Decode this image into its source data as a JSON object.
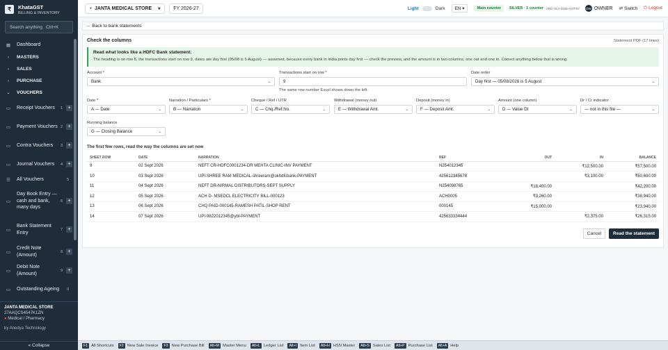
{
  "app": {
    "name": "KhataGST",
    "tagline": "BILLING & INVENTORY"
  },
  "search": {
    "placeholder": "Search anything",
    "shortcut": "Ctrl+K"
  },
  "nav": {
    "dashboard": "Dashboard",
    "masters": "MASTERS",
    "sales": "SALES",
    "purchase": "PURCHASE",
    "vouchers": "VOUCHERS",
    "items": [
      {
        "label": "Receipt Vouchers",
        "count": "1"
      },
      {
        "label": "Payment Vouchers",
        "count": "2"
      },
      {
        "label": "Contra Vouchers",
        "count": "3"
      },
      {
        "label": "Journal Vouchers",
        "count": "4"
      },
      {
        "label": "All Vouchers",
        "count": "5"
      },
      {
        "label": "Day Book Entry — cash and bank, many days",
        "count": "6"
      },
      {
        "label": "Bank Statement Entry",
        "count": "7"
      },
      {
        "label": "Credit Note (Amount)",
        "count": "8"
      },
      {
        "label": "Debit Note (Amount)",
        "count": "9"
      },
      {
        "label": "Outstanding Ageing",
        "count": "0"
      }
    ]
  },
  "footer": {
    "store": "JANTA MEDICAL STORE",
    "gstin": "27AAQCS4547K1ZN",
    "category": "Medical / Pharmacy",
    "by": "by Anedya Technology",
    "collapse": "« Collapse"
  },
  "topbar": {
    "store": "JANTA MEDICAL STORE",
    "fy": "FY 2026-27",
    "light": "Light",
    "dark": "Dark",
    "lang": "EN",
    "main_counter": "Main counter",
    "silver": "SILVER · 1 counter",
    "silver_code": "ANO-SLV-2026-A07F07",
    "owner_initials": "OW",
    "owner": "OWNER",
    "switch": "Switch",
    "logout": "Logout"
  },
  "back": "← Back to bank statements",
  "card": {
    "title": "Check the columns",
    "pdf": "Statement PDF (17 lines)",
    "notice_title": "Read what looks like a HDFC Bank statement.",
    "notice_text": "The heading is on row 8, the transactions start on row 9, dates are day first (05/08 is 5 August) — assumed, because every bank in India prints day first — check the preview, and the amount is in two columns, one out and one in. Correct anything below that is wrong.",
    "account_label": "Account *",
    "account_value": "Bank",
    "txstart_label": "Transactions start on row *",
    "txstart_value": "9",
    "txstart_hint": "The same row number Excel shows down the left.",
    "dateorder_label": "Date order",
    "dateorder_value": "Day first — 05/08/2026 is 5 August",
    "date_label": "Date *",
    "date_value": "A — Date",
    "narr_label": "Narration / Particulars *",
    "narr_value": "B — Narration",
    "cheque_label": "Cheque / Ref / UTR",
    "cheque_value": "C — Chq./Ref.No.",
    "withdraw_label": "Withdrawal (money out)",
    "withdraw_value": "E — Withdrawal Amt.",
    "deposit_label": "Deposit (money in)",
    "deposit_value": "F — Deposit Amt.",
    "amount_label": "Amount (one column)",
    "amount_value": "D — Value Dt",
    "drcr_label": "Dr / Cr indicator",
    "drcr_value": "— not in this file —",
    "balance_label": "Running balance",
    "balance_value": "G — Closing Balance",
    "preview_title": "The first few rows, read the way the columns are set now",
    "cols": [
      "SHEET ROW",
      "DATE",
      "NARRATION",
      "REF",
      "OUT",
      "IN",
      "BALANCE"
    ],
    "rows": [
      [
        "9",
        "02 Sept 2026",
        "NEFT CR-HDFC0001234-DR MEHTA CLINIC-INV PAYMENT",
        "N254012345",
        "",
        "₹12,500.00",
        "₹57,500.00"
      ],
      [
        "10",
        "03 Sept 2026",
        "UPI-SHREE RAM MEDICAL-shreeram@okhdfcbank-PAYMENT",
        "425612345678",
        "",
        "₹3,100.00",
        "₹60,600.00"
      ],
      [
        "11",
        "04 Sept 2026",
        "NEFT DR-NIRMAL DISTRIBUTORS-SEPT SUPPLY",
        "N254098765",
        "₹18,400.00",
        "",
        "₹42,200.00"
      ],
      [
        "12",
        "05 Sept 2026",
        "ACH D- MSEDCL ELECTRICITY BILL-000123",
        "ACH0005",
        "₹3,260.00",
        "",
        "₹38,940.00"
      ],
      [
        "13",
        "06 Sept 2026",
        "CHQ PAID-000145-RAMESH PATIL-SHOP RENT",
        "000145",
        "₹15,000.00",
        "",
        "₹23,940.00"
      ],
      [
        "14",
        "07 Sept 2026",
        "UPI-9822012345@ybl-PAYMENT",
        "425633334444",
        "",
        "₹2,375.00",
        "₹26,315.00"
      ]
    ],
    "cancel": "Cancel",
    "read": "Read the statement"
  },
  "shortcuts": [
    {
      "key": "F1",
      "label": "All Shortcuts"
    },
    {
      "key": "F2",
      "label": "New Sale Invoice"
    },
    {
      "key": "F3",
      "label": "New Purchase Bill"
    },
    {
      "key": "Alt+M",
      "label": "Master Menu"
    },
    {
      "key": "Alt+L",
      "label": "Ledger List"
    },
    {
      "key": "Alt+I",
      "label": "Item List"
    },
    {
      "key": "Alt+H",
      "label": "HSN Master"
    },
    {
      "key": "Alt+S",
      "label": "Sales List"
    },
    {
      "key": "Alt+P",
      "label": "Purchase List"
    },
    {
      "key": "Alt+A",
      "label": "Help"
    }
  ]
}
